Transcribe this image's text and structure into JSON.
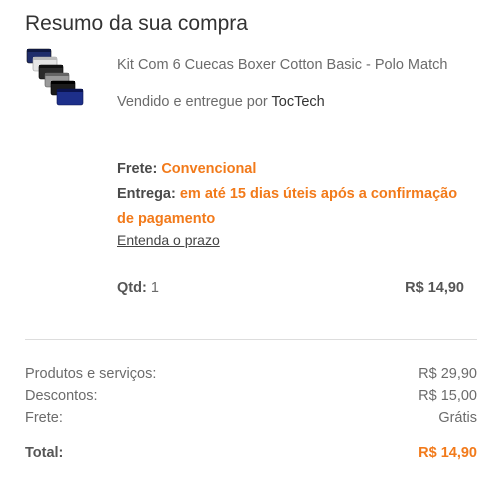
{
  "header": {
    "title": "Resumo da sua compra"
  },
  "product": {
    "thumbnail_icon": "boxer-briefs-product-image",
    "name": "Kit Com 6 Cuecas Boxer Cotton Basic - Polo Match",
    "seller_prefix": "Vendido e entregue por",
    "seller_name": "TocTech"
  },
  "shipping": {
    "frete_label": "Frete:",
    "frete_value": "Convencional",
    "entrega_label": "Entrega:",
    "entrega_value": "em até 15 dias úteis após a confirmação de pagamento",
    "prazo_link": "Entenda o prazo"
  },
  "item": {
    "qty_label": "Qtd:",
    "qty_value": "1",
    "price": "R$ 14,90"
  },
  "summary": {
    "produtos_label": "Produtos e serviços:",
    "produtos_value": "R$ 29,90",
    "descontos_label": "Descontos:",
    "descontos_value": "R$ 15,00",
    "frete_label": "Frete:",
    "frete_value": "Grátis",
    "total_label": "Total:",
    "total_value": "R$ 14,90"
  },
  "colors": {
    "accent": "#f27a1a",
    "text": "#333333",
    "muted": "#6b6b6b",
    "divider": "#dddddd"
  }
}
